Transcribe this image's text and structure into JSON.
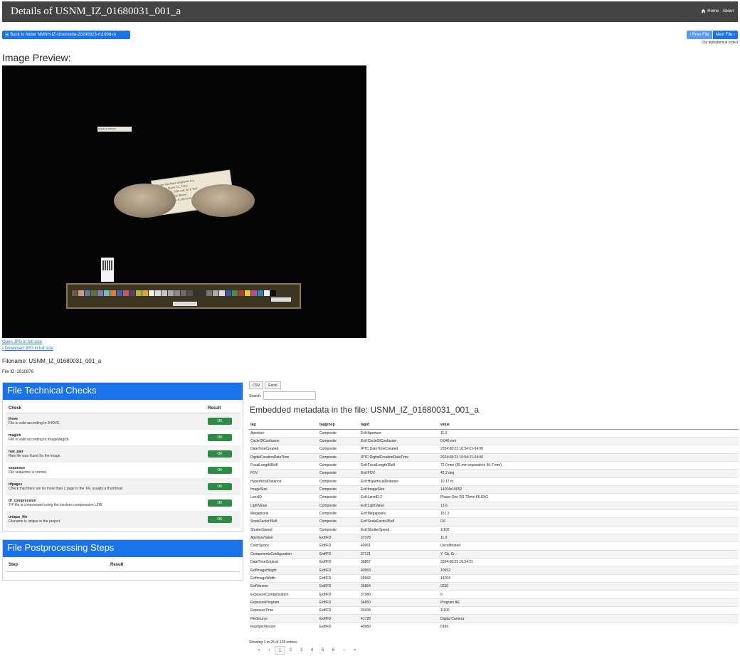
{
  "header": {
    "title": "Details of USNM_IZ_01680031_001_a",
    "home_label": "Home",
    "about_label": "About"
  },
  "toolbar": {
    "back_label": "Back to folder NMNH-IZ-Unionoida-20240823-m100d-m",
    "prev_label": "‹ Prev File",
    "next_label": "Next File ›",
    "order_note": "(by alphabetical order)"
  },
  "preview": {
    "heading": "Image Preview:",
    "open_link": "Open JPG in full size",
    "download_link": "Download JPG in full size",
    "small_label": "NMNH IZ 1680031",
    "tag_lines": [
      "Name: Anodonta subgibbosa Lea",
      "Locality: Harris Co., Texas",
      "Date: April 1, 1935 coll. W. F. Bell",
      "Remarks: Buffalo Bayou",
      "No. 9761 — 1 a (Collection)"
    ]
  },
  "file": {
    "filename": "Filename: USNM_IZ_01680031_001_a",
    "file_id": "File ID: 2810876"
  },
  "checks": {
    "title": "File Technical Checks",
    "col_check": "Check",
    "col_result": "Result",
    "items": [
      {
        "name": "jhove",
        "desc": "File is valid according to JHOVE.",
        "result": "OK"
      },
      {
        "name": "magick",
        "desc": "File is valid according to ImageMagick.",
        "result": "OK"
      },
      {
        "name": "raw_pair",
        "desc": "Raw file was found for the image.",
        "result": "OK"
      },
      {
        "name": "sequence",
        "desc": "File sequence is correct.",
        "result": "OK"
      },
      {
        "name": "tifpages",
        "desc": "Check that there are no more than 1 page in the TIF, usually a thumbnail.",
        "result": "OK"
      },
      {
        "name": "tif_compression",
        "desc": "TIF file is compressed using the lossless compression LZW.",
        "result": "OK"
      },
      {
        "name": "unique_file",
        "desc": "Filename is unique in the project.",
        "result": "OK"
      }
    ]
  },
  "postprocessing": {
    "title": "File Postprocessing Steps",
    "col_step": "Step",
    "col_result": "Result"
  },
  "metadata": {
    "csv_label": "CSV",
    "excel_label": "Excel",
    "search_label": "Search:",
    "title": "Embedded metadata in the file: USNM_IZ_01680031_001_a",
    "columns": [
      "tag",
      "taggroup",
      "tagid",
      "value"
    ],
    "rows": [
      [
        "Aperture",
        "Composite",
        "Exif:Aperture",
        "11.0"
      ],
      [
        "CircleOfConfusion",
        "Composite",
        "Exif:CircleOfConfusion",
        "0.046 mm"
      ],
      [
        "DateTimeCreated",
        "Composite",
        "IPTC:DateTimeCreated",
        "2024:08:23 10:54:21-04:00"
      ],
      [
        "DigitalCreationDateTime",
        "Composite",
        "IPTC:DigitalCreationDateTime",
        "2024:08:23 10:54:21-04:00"
      ],
      [
        "FocalLength35efl",
        "Composite",
        "Exif:FocalLength35efl",
        "72.0 mm (35 mm equivalent: 40.7 mm)"
      ],
      [
        "FOV",
        "Composite",
        "Exif:FOV",
        "42.2 deg"
      ],
      [
        "HyperfocalDistance",
        "Composite",
        "Exif:HyperfocalDistance",
        "10.17 m"
      ],
      [
        "ImageSize",
        "Composite",
        "Exif:ImageSize",
        "14204x10652"
      ],
      [
        "LensID",
        "Composite",
        "Exif:LensID-2",
        "Phase One RS 72mm f/6.8XG"
      ],
      [
        "LightValue",
        "Composite",
        "Exif:LightValue",
        "13.6"
      ],
      [
        "Megapixels",
        "Composite",
        "Exif:Megapixels",
        "151.3"
      ],
      [
        "ScaleFactor35efl",
        "Composite",
        "Exif:ScaleFactor35efl",
        "0.6"
      ],
      [
        "ShutterSpeed",
        "Composite",
        "Exif:ShutterSpeed",
        "1/100"
      ],
      [
        "ApertureValue",
        "ExifIFD",
        "37378",
        "11.0"
      ],
      [
        "ColorSpace",
        "ExifIFD",
        "40961",
        "Uncalibrated"
      ],
      [
        "ComponentsConfiguration",
        "ExifIFD",
        "37121",
        "Y, Cb, Cr, -"
      ],
      [
        "DateTimeOriginal",
        "ExifIFD",
        "36867",
        "2024:08:23 10:54:21"
      ],
      [
        "ExifImageHeight",
        "ExifIFD",
        "40963",
        "10652"
      ],
      [
        "ExifImageWidth",
        "ExifIFD",
        "40962",
        "14204"
      ],
      [
        "ExifVersion",
        "ExifIFD",
        "36864",
        "0230"
      ],
      [
        "ExposureCompensation",
        "ExifIFD",
        "37380",
        "0"
      ],
      [
        "ExposureProgram",
        "ExifIFD",
        "34850",
        "Program AE"
      ],
      [
        "ExposureTime",
        "ExifIFD",
        "33434",
        "1/100"
      ],
      [
        "FileSource",
        "ExifIFD",
        "41728",
        "Digital Camera"
      ],
      [
        "FlashpixVersion",
        "ExifIFD",
        "40960",
        "0100"
      ]
    ],
    "info": "Showing 1 to 25 of 128 entries",
    "pages": [
      "«",
      "‹",
      "1",
      "2",
      "3",
      "4",
      "5",
      "6",
      "›",
      "»"
    ],
    "current_page": "1"
  },
  "colors": {
    "topbar": "#444444",
    "primary": "#1a73e8",
    "ok": "#2e8b47"
  }
}
